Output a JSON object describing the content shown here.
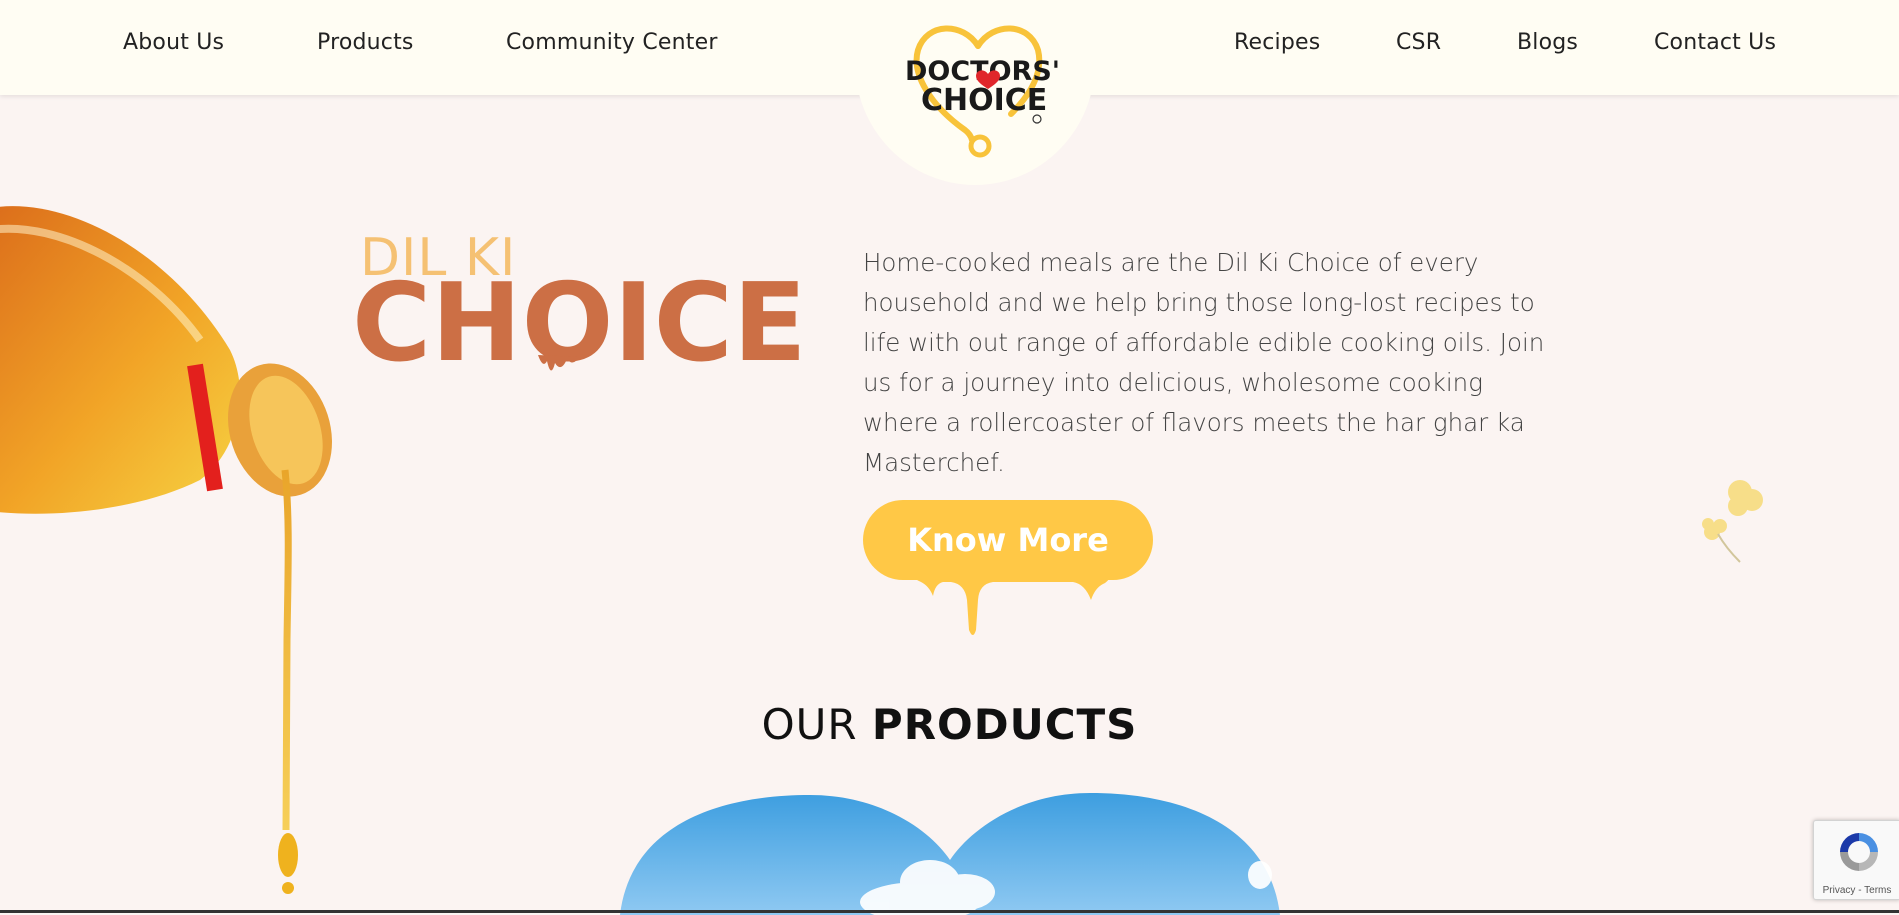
{
  "nav": {
    "left": [
      "About Us",
      "Products",
      "Community Center"
    ],
    "right": [
      "Recipes",
      "CSR",
      "Blogs",
      "Contact Us"
    ]
  },
  "logo": {
    "line1": "DOCTORS'",
    "line2": "CHOICE",
    "icon": "heart-stethoscope-logo"
  },
  "hero": {
    "eyebrow": "DIL KI",
    "headline": "CHOICE",
    "body": "Home-cooked meals are the Dil Ki Choice of every household and we help bring those long-lost recipes to life with out range of affordable edible cooking oils. Join us for a journey into delicious, wholesome cooking where a rollercoaster of flavors meets the har ghar ka Masterchef.",
    "cta": "Know More"
  },
  "products": {
    "heading_light": "OUR",
    "heading_bold": "PRODUCTS"
  },
  "recaptcha": {
    "footer": "Privacy - Terms"
  },
  "colors": {
    "page_bg": "#fbf4f2",
    "header_bg": "#fffdf3",
    "accent_yellow": "#ffc846",
    "choice_orange": "#cc6f45",
    "dilki_peach": "#f5c173"
  }
}
